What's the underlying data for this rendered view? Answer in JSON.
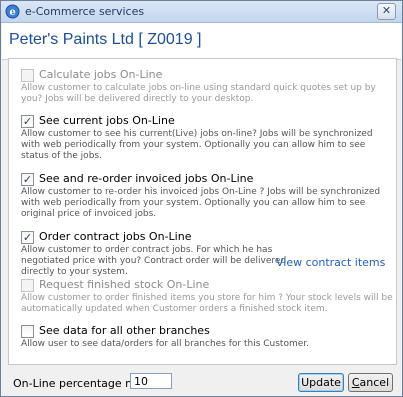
{
  "window": {
    "title": "e-Commerce services",
    "close_glyph": "✕"
  },
  "header": {
    "title": "Peter's Paints Ltd [ Z0019 ]"
  },
  "options": [
    {
      "label": "Calculate jobs On-Line",
      "checked": false,
      "enabled": false,
      "description": "Allow customer to calculate jobs on-line using standard quick quotes set up by you? Jobs will be delivered directly to your desktop."
    },
    {
      "label": "See current jobs On-Line",
      "checked": true,
      "enabled": true,
      "description": "Allow customer to see his current(Live) jobs on-line? Jobs will be synchronized with web periodically from your system. Optionally you can allow him to see status of the jobs."
    },
    {
      "label": "See and re-order invoiced jobs On-Line",
      "checked": true,
      "enabled": true,
      "description": "Allow customer to re-order his invoiced jobs On-Line ? Jobs will be synchronized with web periodically from your system. Optionally you can allow him to see original price of invoiced jobs."
    },
    {
      "label": "Order contract jobs On-Line",
      "checked": true,
      "enabled": true,
      "description": "Allow customer to order contract jobs. For which he has negotiated price with you? Contract order will be delivered directly to your system."
    },
    {
      "label": "Request finished stock On-Line",
      "checked": false,
      "enabled": false,
      "description": "Allow customer to order finished items you store for him ? Your stock levels will be automatically updated when Customer orders a finished stock item."
    },
    {
      "label": "See data for all other branches",
      "checked": false,
      "enabled": true,
      "description": "Allow user to see data/orders for all branches for this Customer."
    }
  ],
  "contract_link": "View contract items",
  "footer": {
    "markup_label": "On-Line percentage markup",
    "markup_value": "10",
    "update_label": "Update",
    "cancel_label": "Cancel"
  },
  "colors": {
    "header_title": "#1b4f9c",
    "link": "#2060c8"
  }
}
